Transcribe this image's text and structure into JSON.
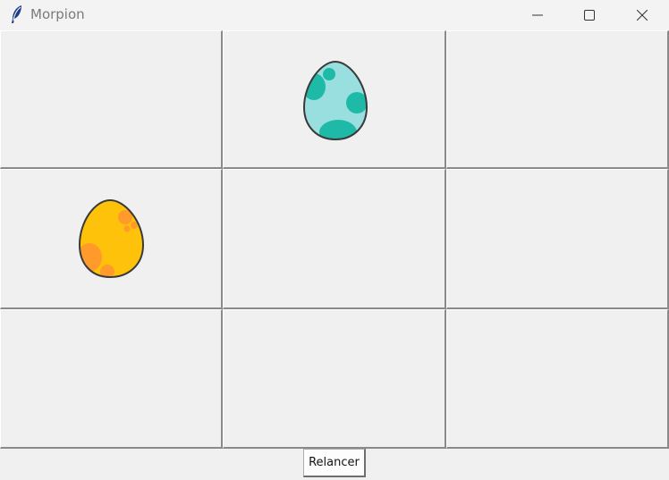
{
  "window": {
    "title": "Morpion"
  },
  "controls": {
    "minimize": "minimize-icon",
    "maximize": "maximize-icon",
    "close": "close-icon"
  },
  "board": {
    "cells": [
      {
        "row": 0,
        "col": 0,
        "piece": ""
      },
      {
        "row": 0,
        "col": 1,
        "piece": "teal-egg"
      },
      {
        "row": 0,
        "col": 2,
        "piece": ""
      },
      {
        "row": 1,
        "col": 0,
        "piece": "yellow-egg"
      },
      {
        "row": 1,
        "col": 1,
        "piece": ""
      },
      {
        "row": 1,
        "col": 2,
        "piece": ""
      },
      {
        "row": 2,
        "col": 0,
        "piece": ""
      },
      {
        "row": 2,
        "col": 1,
        "piece": ""
      },
      {
        "row": 2,
        "col": 2,
        "piece": ""
      }
    ]
  },
  "pieces": {
    "teal-egg": {
      "base": "#9adfe0",
      "spots": "#1fbaa7"
    },
    "yellow-egg": {
      "base": "#ffc20a",
      "spots": "#ff9a2b"
    }
  },
  "restart_button": {
    "label": "Relancer"
  }
}
